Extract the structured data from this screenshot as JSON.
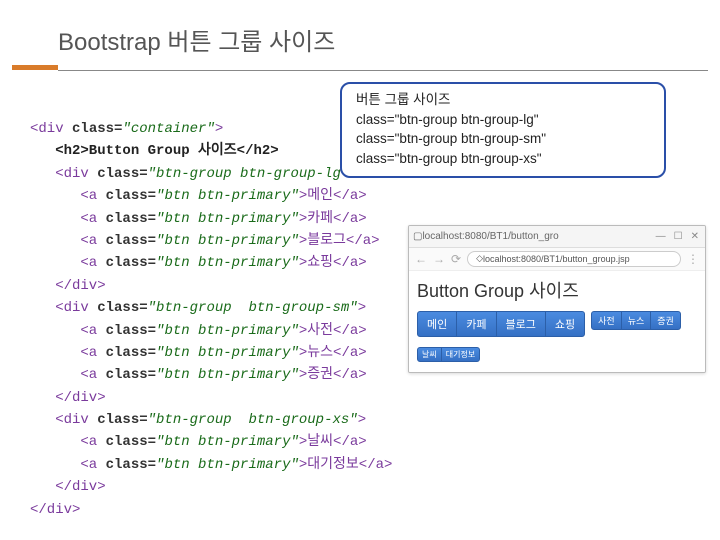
{
  "slide": {
    "title": "Bootstrap 버튼 그룹 사이즈"
  },
  "callout": {
    "line1": "버튼 그룹 사이즈",
    "line2": "class=\"btn-group btn-group-lg\"",
    "line3": "class=\"btn-group btn-group-sm\"",
    "line4": "class=\"btn-group  btn-group-xs\""
  },
  "code": {
    "l1a": "<div ",
    "l1b": "class=",
    "l1c": "\"container\"",
    "l1d": ">",
    "l2": "   <h2>Button Group 사이즈</h2>",
    "l3a": "   <div ",
    "l3b": "class=",
    "l3c": "\"btn-group btn-group-lg\"",
    "l3d": ">",
    "l4a": "      <a ",
    "l4b": "class=",
    "l4c": "\"btn btn-primary\"",
    "l4d": ">메인</a>",
    "l5a": "      <a ",
    "l5b": "class=",
    "l5c": "\"btn btn-primary\"",
    "l5d": ">카페</a>",
    "l6a": "      <a ",
    "l6b": "class=",
    "l6c": "\"btn btn-primary\"",
    "l6d": ">블로그</a>",
    "l7a": "      <a ",
    "l7b": "class=",
    "l7c": "\"btn btn-primary\"",
    "l7d": ">쇼핑</a>",
    "l8": "   </div>",
    "l9a": "   <div ",
    "l9b": "class=",
    "l9c": "\"btn-group  btn-group-sm\"",
    "l9d": ">",
    "l10a": "      <a ",
    "l10b": "class=",
    "l10c": "\"btn btn-primary\"",
    "l10d": ">사전</a>",
    "l11a": "      <a ",
    "l11b": "class=",
    "l11c": "\"btn btn-primary\"",
    "l11d": ">뉴스</a>",
    "l12a": "      <a ",
    "l12b": "class=",
    "l12c": "\"btn btn-primary\"",
    "l12d": ">증권</a>",
    "l13": "   </div>",
    "l14a": "   <div ",
    "l14b": "class=",
    "l14c": "\"btn-group  btn-group-xs\"",
    "l14d": ">",
    "l15a": "      <a ",
    "l15b": "class=",
    "l15c": "\"btn btn-primary\"",
    "l15d": ">날씨</a>",
    "l16a": "      <a ",
    "l16b": "class=",
    "l16c": "\"btn btn-primary\"",
    "l16d": ">대기정보</a>",
    "l17": "   </div>",
    "l18": "</div>"
  },
  "browser": {
    "tab_url": "localhost:8080/BT1/button_gro",
    "address": "localhost:8080/BT1/button_group.jsp",
    "heading": "Button Group 사이즈",
    "lg": [
      "메인",
      "카페",
      "블로그",
      "쇼핑"
    ],
    "sm": [
      "사전",
      "뉴스",
      "증권"
    ],
    "xs": [
      "날씨",
      "대기정보"
    ]
  }
}
